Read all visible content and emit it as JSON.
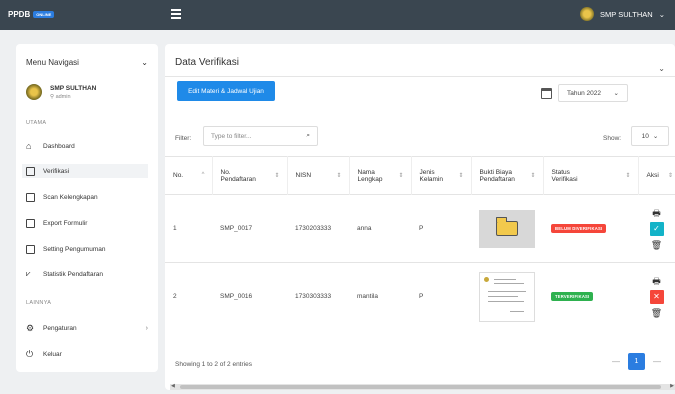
{
  "topbar": {
    "brand": "PPDB",
    "brand_badge": "ONLINE",
    "user_label": "SMP SULTHAN",
    "user_chevron": "⌄"
  },
  "sidebar": {
    "menu_title": "Menu Navigasi",
    "menu_chevron": "⌄",
    "profile_name": "SMP SULTHAN",
    "profile_role": "admin",
    "section_main": "UTAMA",
    "section_other": "LAINNYA",
    "items": [
      {
        "label": "Dashboard",
        "icon": "home-icon"
      },
      {
        "label": "Verifikasi",
        "icon": "file-check-icon"
      },
      {
        "label": "Scan Kelengkapan",
        "icon": "scan-icon"
      },
      {
        "label": "Export Formulir",
        "icon": "export-icon"
      },
      {
        "label": "Setting Pengumuman",
        "icon": "monitor-icon"
      },
      {
        "label": "Statistik Pendaftaran",
        "icon": "chart-icon"
      },
      {
        "label": "Pengaturan",
        "icon": "settings-icon"
      },
      {
        "label": "Keluar",
        "icon": "power-icon"
      }
    ]
  },
  "main": {
    "title": "Data Verifikasi",
    "edit_button": "Edit Materi & Jadwal Ujian",
    "year_select": "Tahun 2022",
    "filter_label": "Filter:",
    "filter_placeholder": "Type to filter...",
    "show_label": "Show:",
    "show_value": "10",
    "columns": [
      "No.",
      "No. Pendaftaran",
      "NISN",
      "Nama Lengkap",
      "Jenis Kelamin",
      "Bukti Biaya Pendaftaran",
      "Status Verifikasi",
      "Aksi"
    ],
    "rows": [
      {
        "no": "1",
        "no_pendaftaran": "SMP_0017",
        "nisn": "1730203333",
        "nama": "anna",
        "jk": "P",
        "status": "BELUM DIVERIFIKASI",
        "status_color": "#f5463a"
      },
      {
        "no": "2",
        "no_pendaftaran": "SMP_0016",
        "nisn": "1730303333",
        "nama": "mantila",
        "jk": "P",
        "status": "TERVERIFIKASI",
        "status_color": "#2eb14f"
      }
    ],
    "footer_info": "Showing 1 to 2 of 2 entries",
    "pagination": {
      "prev": "—",
      "current": "1",
      "next": "—"
    }
  }
}
